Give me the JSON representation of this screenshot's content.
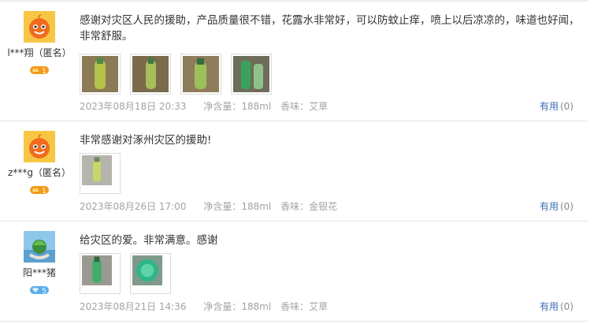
{
  "reviews": [
    {
      "username": "l***翔（匿名）",
      "level": "1",
      "text": "感谢对灾区人民的援助，产品质量很不错，花露水非常好，可以防蚊止痒，喷上以后凉凉的，味道也好闻，非常舒服。",
      "photo_count": 4,
      "date": "2023年08月18日 20:33",
      "volume_label": "净含量：",
      "volume": "188ml",
      "scent_label": "香味：",
      "scent": "艾草",
      "useful_label": "有用",
      "useful_count": "(0)"
    },
    {
      "username": "z***g（匿名）",
      "level": "1",
      "text": "非常感谢对涿州灾区的援助!",
      "photo_count": 1,
      "date": "2023年08月26日 17:00",
      "volume_label": "净含量：",
      "volume": "188ml",
      "scent_label": "香味：",
      "scent": "金银花",
      "useful_label": "有用",
      "useful_count": "(0)"
    },
    {
      "username": "阳***猪",
      "level": "5",
      "text": "给灾区的爱。非常满意。感谢",
      "photo_count": 2,
      "date": "2023年08月21日 14:36",
      "volume_label": "净含量：",
      "volume": "188ml",
      "scent_label": "香味：",
      "scent": "艾草",
      "useful_label": "有用",
      "useful_count": "(0)"
    }
  ],
  "colors": {
    "link": "#3a6eb5",
    "meta": "#a3a3a3",
    "level_badge": "#f39a1c",
    "diamond_badge": "#5aaee8"
  }
}
